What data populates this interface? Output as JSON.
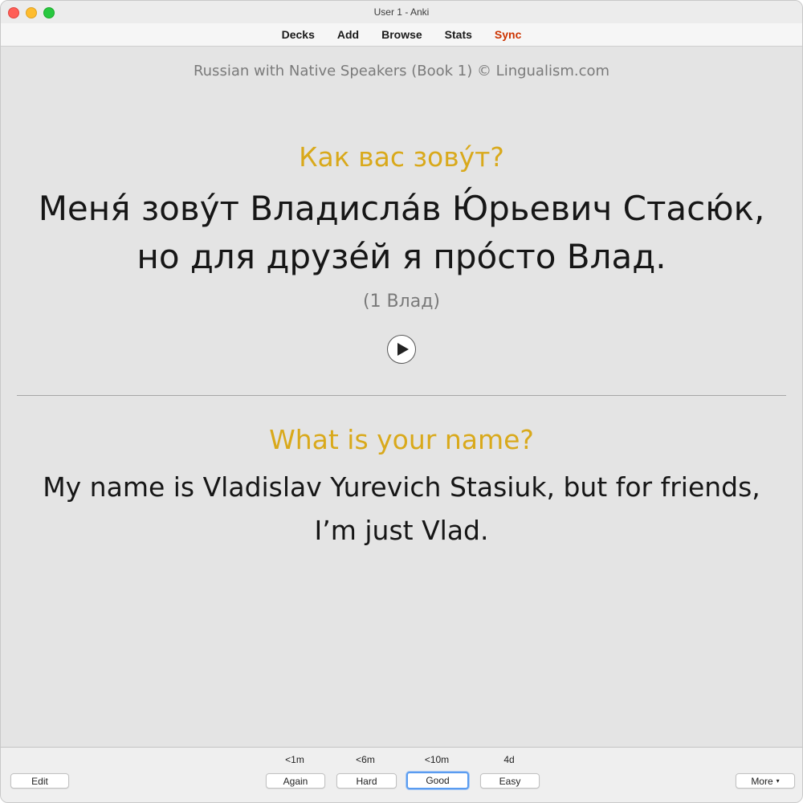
{
  "window": {
    "title": "User 1 - Anki"
  },
  "toolbar": {
    "decks": "Decks",
    "add": "Add",
    "browse": "Browse",
    "stats": "Stats",
    "sync": "Sync",
    "sync_color": "#cc3300"
  },
  "card": {
    "deck_title": "Russian with Native Speakers (Book 1) © Lingualism.com",
    "question_ru": "Как вас зову́т?",
    "answer_ru_line1": "Меня́ зову́т Владисла́в Ю́рьевич Стасю́к,",
    "answer_ru_line2": "но для друзе́й я про́сто Влад.",
    "note_ru": "(1 Влад)",
    "play_icon": "play-icon",
    "question_en": "What is your name?",
    "answer_en_line1": "My name is Vladislav Yurevich Stasiuk, but for friends,",
    "answer_en_line2": "I’m just Vlad.",
    "accent_color": "#d9a91b"
  },
  "bottombar": {
    "edit_label": "Edit",
    "more_label": "More",
    "more_caret": "▾",
    "answers": [
      {
        "interval": "<1m",
        "label": "Again"
      },
      {
        "interval": "<6m",
        "label": "Hard"
      },
      {
        "interval": "<10m",
        "label": "Good"
      },
      {
        "interval": "4d",
        "label": "Easy"
      }
    ],
    "focused_button": "Good"
  }
}
